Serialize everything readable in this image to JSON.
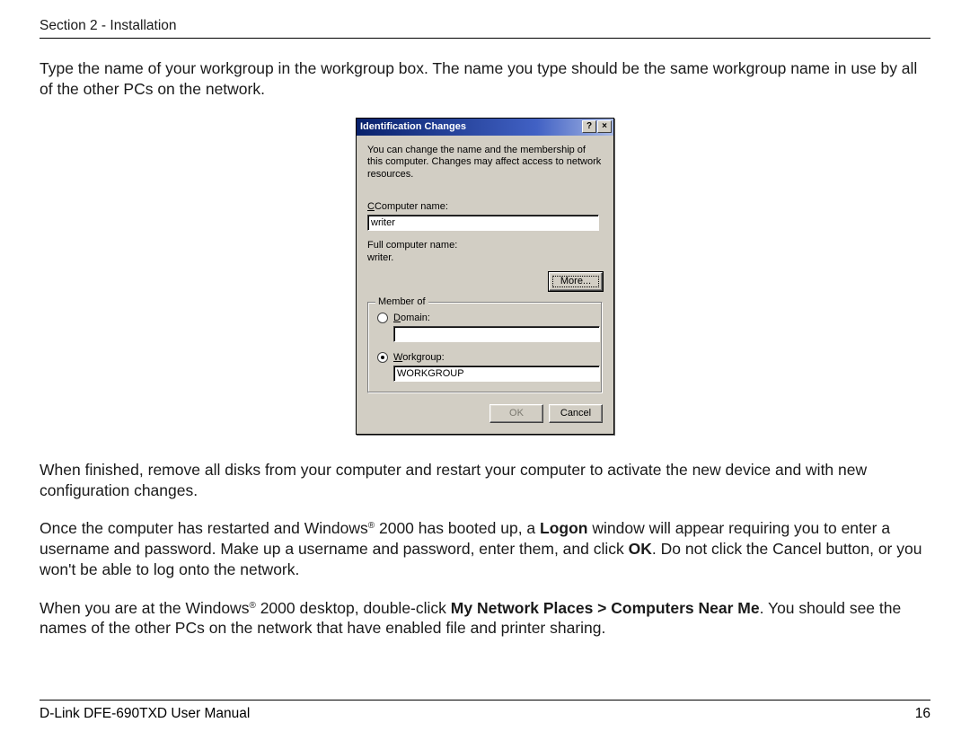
{
  "header": {
    "section": "Section 2 - Installation"
  },
  "paragraphs": {
    "p1": "Type the name of your workgroup in the workgroup box. The name you type should be the same workgroup name in use by all of the other PCs on the network.",
    "p2": "When finished, remove all disks from your computer and restart your computer to activate the new device and with new configuration changes.",
    "p3a": "Once the computer has restarted and Windows",
    "p3b": " 2000 has booted up, a ",
    "p3_bold1": "Logon",
    "p3c": " window will appear requiring you to enter a username and password. Make up a username and password, enter them, and click ",
    "p3_bold2": "OK",
    "p3d": ". Do not click the Cancel button, or you won't be able to log onto the network.",
    "p4a": "When you are at the Windows",
    "p4b": " 2000 desktop, double-click ",
    "p4_bold": "My Network Places > Computers Near Me",
    "p4c": ". You should see the names of the other PCs on the network that have enabled file and printer sharing."
  },
  "dialog": {
    "title": "Identification Changes",
    "help_glyph": "?",
    "close_glyph": "×",
    "desc": "You can change the name and the membership of this computer. Changes may affect access to network resources.",
    "computer_name_label": "Computer name:",
    "computer_name_value": "writer",
    "full_name_label": "Full computer name:",
    "full_name_value": "writer.",
    "more_btn": "More...",
    "memberof_legend": "Member of",
    "domain_label_pre": "D",
    "domain_label_post": "omain:",
    "domain_value": "",
    "workgroup_label_pre": "W",
    "workgroup_label_post": "orkgroup:",
    "workgroup_value": "WORKGROUP",
    "ok_btn": "OK",
    "cancel_btn": "Cancel"
  },
  "footer": {
    "left": "D-Link DFE-690TXD User Manual",
    "right": "16"
  }
}
